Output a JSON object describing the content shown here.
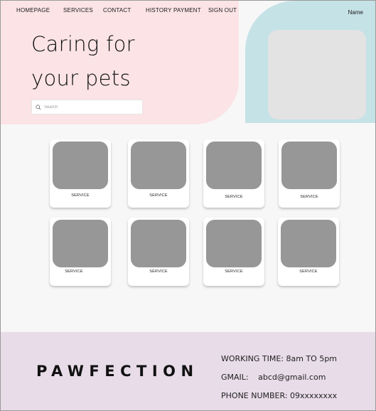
{
  "nav": {
    "items": [
      "HOMEPAGE",
      "SERVICES",
      "CONTACT",
      "HISTORY PAYMENT",
      "SIGN OUT"
    ],
    "user_name": "Name"
  },
  "hero": {
    "headline_line1": "Caring for",
    "headline_line2": "your pets",
    "search_placeholder": "Search"
  },
  "services": {
    "cards": [
      {
        "label": "SERVICE"
      },
      {
        "label": "SERVICE"
      },
      {
        "label": "SERVICE"
      },
      {
        "label": "SERVICE"
      },
      {
        "label": "SERVICE"
      },
      {
        "label": "SERVICE"
      },
      {
        "label": "SERVICE"
      },
      {
        "label": "SERVICE"
      }
    ]
  },
  "footer": {
    "brand": "PAWFECTION",
    "working_time": "WORKING TIME: 8am TO  5pm",
    "gmail_label": "GMAIL:",
    "gmail_value": "abcd@gmail.com",
    "phone": "PHONE NUMBER: 09xxxxxxxx"
  },
  "colors": {
    "hero_pink": "#fbe3e6",
    "hero_blue": "#c5e2e7",
    "footer_bg": "#e8dce8",
    "placeholder_gray": "#979797"
  }
}
